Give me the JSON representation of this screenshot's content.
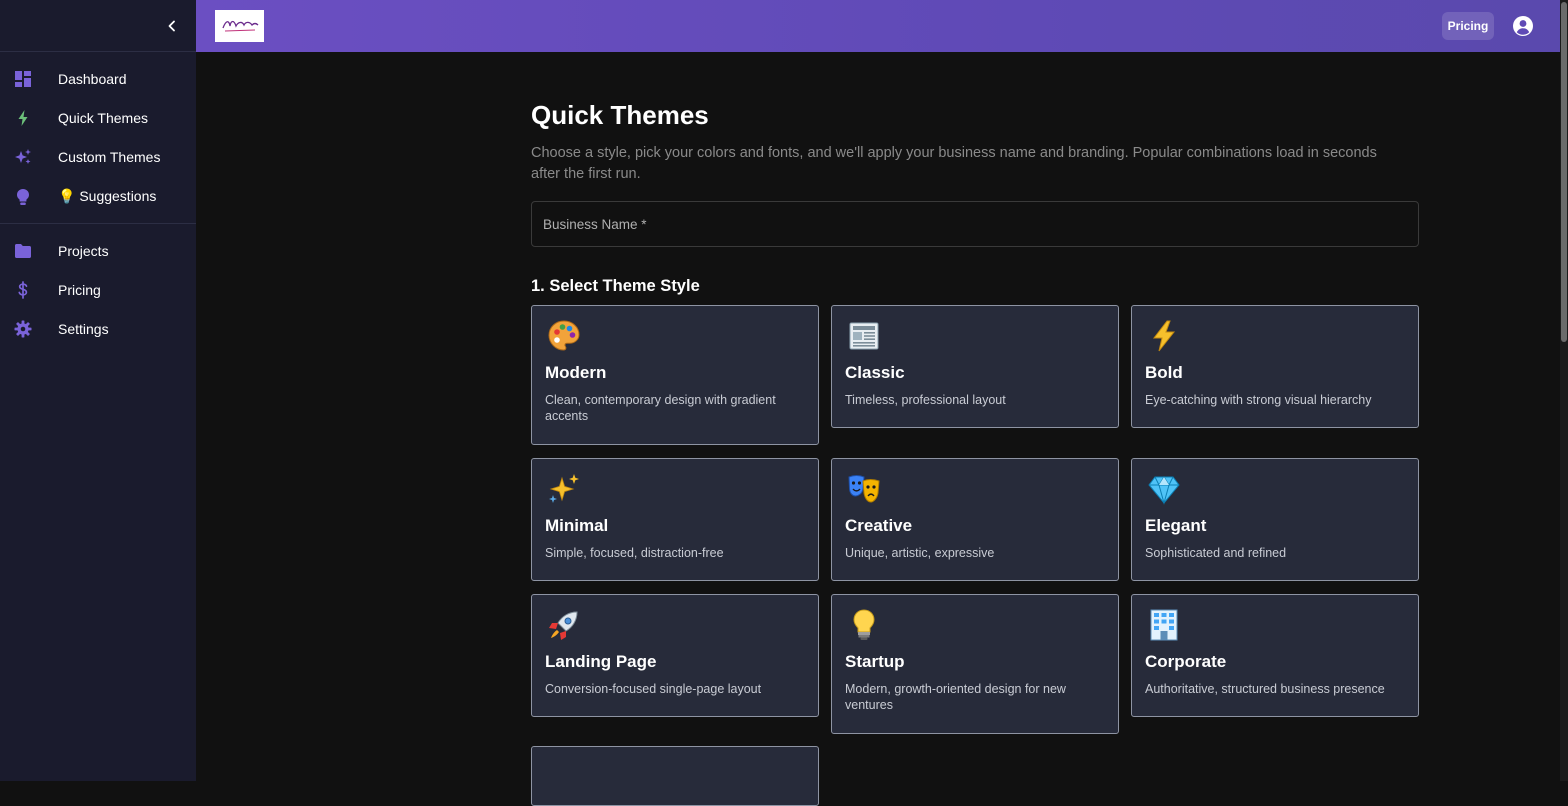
{
  "sidebar": {
    "collapse_icon": "chevron-left-icon",
    "items": [
      {
        "label": "Dashboard",
        "icon": "dashboard-icon"
      },
      {
        "label": "Quick Themes",
        "icon": "bolt-icon"
      },
      {
        "label": "Custom Themes",
        "icon": "sparkles-icon"
      },
      {
        "label": "💡 Suggestions",
        "icon": "lightbulb-icon"
      }
    ],
    "items2": [
      {
        "label": "Projects",
        "icon": "folder-icon"
      },
      {
        "label": "Pricing",
        "icon": "dollar-icon"
      },
      {
        "label": "Settings",
        "icon": "gear-icon"
      }
    ]
  },
  "topbar": {
    "pricing_label": "Pricing",
    "avatar_icon": "account-circle-icon"
  },
  "main": {
    "title": "Quick Themes",
    "description": "Choose a style, pick your colors and fonts, and we'll apply your business name and branding. Popular combinations load in seconds after the first run.",
    "business_name_label": "Business Name *",
    "section_title": "1. Select Theme Style",
    "themes": [
      {
        "icon": "🎨",
        "title": "Modern",
        "desc": "Clean, contemporary design with gradient accents"
      },
      {
        "icon": "📰",
        "title": "Classic",
        "desc": "Timeless, professional layout"
      },
      {
        "icon": "⚡",
        "title": "Bold",
        "desc": "Eye-catching with strong visual hierarchy"
      },
      {
        "icon": "✨",
        "title": "Minimal",
        "desc": "Simple, focused, distraction-free"
      },
      {
        "icon": "🎭",
        "title": "Creative",
        "desc": "Unique, artistic, expressive"
      },
      {
        "icon": "💎",
        "title": "Elegant",
        "desc": "Sophisticated and refined"
      },
      {
        "icon": "🚀",
        "title": "Landing Page",
        "desc": "Conversion-focused single-page layout"
      },
      {
        "icon": "💡",
        "title": "Startup",
        "desc": "Modern, growth-oriented design for new ventures"
      },
      {
        "icon": "🏢",
        "title": "Corporate",
        "desc": "Authoritative, structured business presence"
      }
    ]
  },
  "colors": {
    "sidebar_bg": "#1a1b2d",
    "accent_purple": "#6b4fc2",
    "icon_purple": "#7a63d9",
    "icon_green": "#6cc07a",
    "card_bg": "#272b3a",
    "page_bg": "#111111"
  }
}
